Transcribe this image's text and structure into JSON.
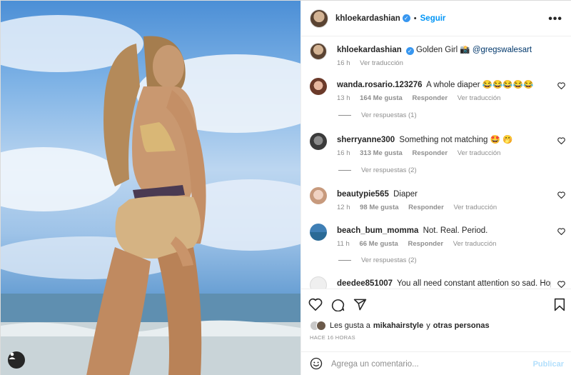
{
  "post": {
    "author": "khloekardashian",
    "follow_label": "Seguir",
    "caption_text": "Golden Girl 📸",
    "caption_mention": "@gregswalesart",
    "caption_time": "16 h",
    "caption_translate": "Ver traducción"
  },
  "comments": [
    {
      "user": "wanda.rosario.123276",
      "text": "A whole diaper 😂😂😂😂😂",
      "time": "13 h",
      "likes": "164 Me gusta",
      "reply": "Responder",
      "translate": "Ver traducción",
      "replies": "Ver respuestas (1)"
    },
    {
      "user": "sherryanne300",
      "text": "Something not matching 🤩 🤭",
      "time": "16 h",
      "likes": "313 Me gusta",
      "reply": "Responder",
      "translate": "Ver traducción",
      "replies": "Ver respuestas (2)"
    },
    {
      "user": "beautypie565",
      "text": "Diaper",
      "time": "12 h",
      "likes": "98 Me gusta",
      "reply": "Responder",
      "translate": "Ver traducción"
    },
    {
      "user": "beach_bum_momma",
      "text": "Not. Real. Period.",
      "time": "11 h",
      "likes": "66 Me gusta",
      "reply": "Responder",
      "translate": "Ver traducción",
      "replies": "Ver respuestas (2)"
    },
    {
      "user": "deedee851007",
      "text": "You all need constant attention so sad. Hope"
    }
  ],
  "likes": {
    "prefix": "Les gusta a",
    "user": "mikahairstyle",
    "connector": "y",
    "others": "otras personas"
  },
  "time_ago": "HACE 16 HORAS",
  "composer": {
    "placeholder": "Agrega un comentario...",
    "publish_label": "Publicar"
  },
  "icons": [
    "heart-icon",
    "comment-icon",
    "share-icon",
    "bookmark-icon",
    "emoji-icon",
    "more-icon",
    "user-tag-icon",
    "verified-icon"
  ],
  "colors": {
    "accent": "#0095f6",
    "verified": "#3897f0",
    "muted": "#8e8e8e",
    "publish_disabled": "#b2dffc"
  }
}
